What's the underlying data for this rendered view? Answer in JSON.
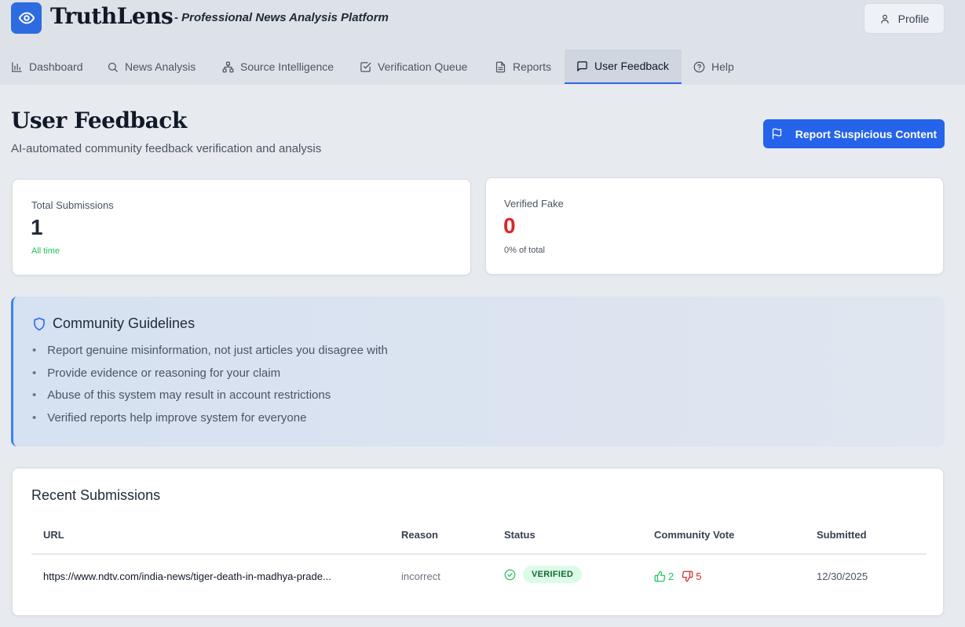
{
  "app": {
    "name": "TruthLens",
    "tagline": "- Professional News Analysis Platform",
    "profile_label": "Profile"
  },
  "nav": {
    "items": [
      {
        "label": "Dashboard",
        "icon": "bar-chart-icon"
      },
      {
        "label": "News Analysis",
        "icon": "search-icon"
      },
      {
        "label": "Source Intelligence",
        "icon": "network-icon"
      },
      {
        "label": "Verification Queue",
        "icon": "check-square-icon"
      },
      {
        "label": "Reports",
        "icon": "document-icon"
      },
      {
        "label": "User Feedback",
        "icon": "message-square-icon",
        "active": true
      },
      {
        "label": "Help",
        "icon": "help-circle-icon"
      }
    ]
  },
  "page": {
    "title": "User Feedback",
    "subtitle": "AI-automated community feedback verification and analysis",
    "report_button": "Report Suspicious Content"
  },
  "stats": {
    "total": {
      "label": "Total Submissions",
      "value": "1",
      "note": "All time"
    },
    "fake": {
      "label": "Verified Fake",
      "value": "0",
      "note": "0% of total"
    }
  },
  "guidelines": {
    "title": "Community Guidelines",
    "items": [
      "Report genuine misinformation, not just articles you disagree with",
      "Provide evidence or reasoning for your claim",
      "Abuse of this system may result in account restrictions",
      "Verified reports help improve system for everyone"
    ]
  },
  "submissions": {
    "title": "Recent Submissions",
    "columns": [
      "URL",
      "Reason",
      "Status",
      "Community Vote",
      "Submitted"
    ],
    "rows": [
      {
        "url": "https://www.ndtv.com/india-news/tiger-death-in-madhya-prade...",
        "reason": "incorrect",
        "status": "VERIFIED",
        "upvotes": "2",
        "downvotes": "5",
        "submitted": "12/30/2025"
      }
    ]
  },
  "colors": {
    "accent": "#2563eb",
    "positive": "#22c55e",
    "negative": "#dc2626",
    "badge_bg": "#dcfce7",
    "badge_text": "#166534"
  }
}
